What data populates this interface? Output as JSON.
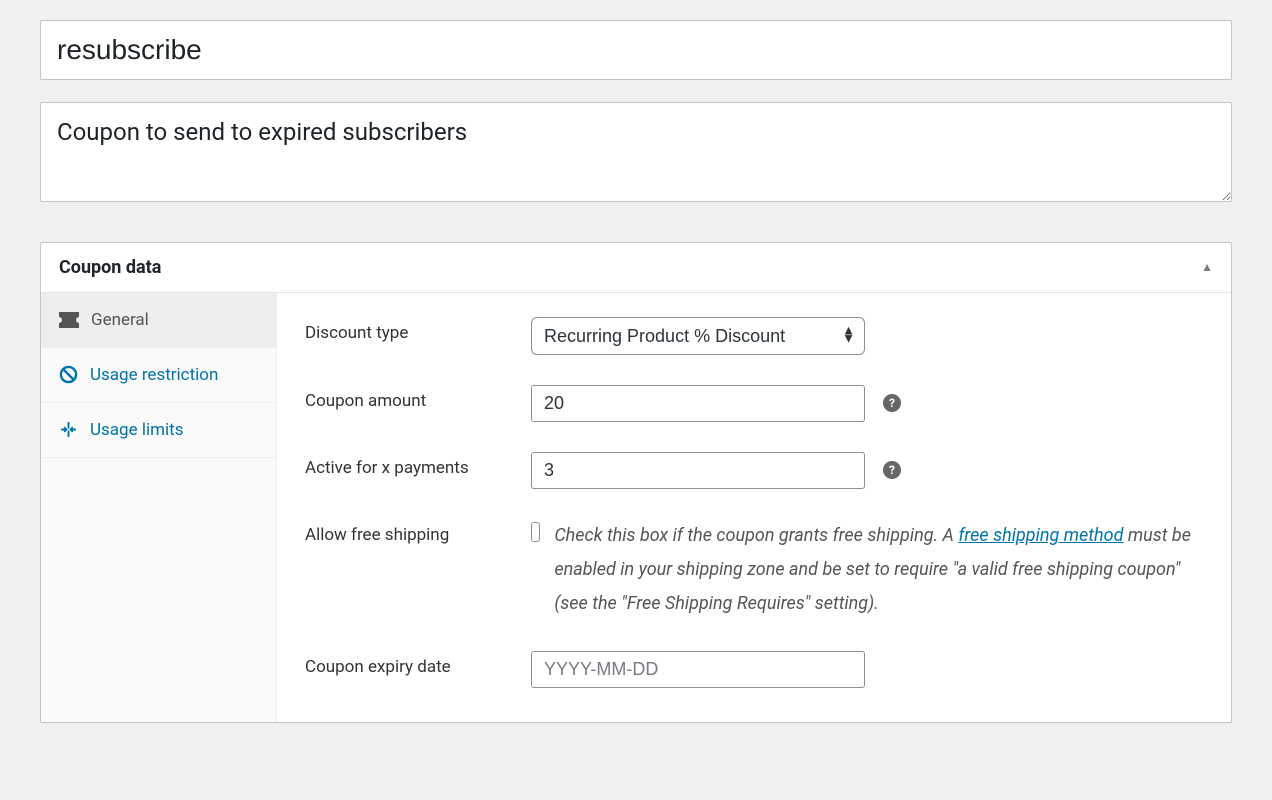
{
  "title": "resubscribe",
  "description": "Coupon to send to expired subscribers",
  "metabox": {
    "heading": "Coupon data",
    "tabs": {
      "general": "General",
      "usage_restriction": "Usage restriction",
      "usage_limits": "Usage limits"
    },
    "fields": {
      "discount_type": {
        "label": "Discount type",
        "selected": "Recurring Product % Discount"
      },
      "coupon_amount": {
        "label": "Coupon amount",
        "value": "20"
      },
      "active_for_x": {
        "label": "Active for x payments",
        "value": "3"
      },
      "free_shipping": {
        "label": "Allow free shipping",
        "text_pre": "Check this box if the coupon grants free shipping. A ",
        "link_text": "free shipping method",
        "text_post": " must be enabled in your shipping zone and be set to require \"a valid free shipping coupon\" (see the \"Free Shipping Requires\" setting)."
      },
      "expiry": {
        "label": "Coupon expiry date",
        "placeholder": "YYYY-MM-DD"
      }
    }
  }
}
